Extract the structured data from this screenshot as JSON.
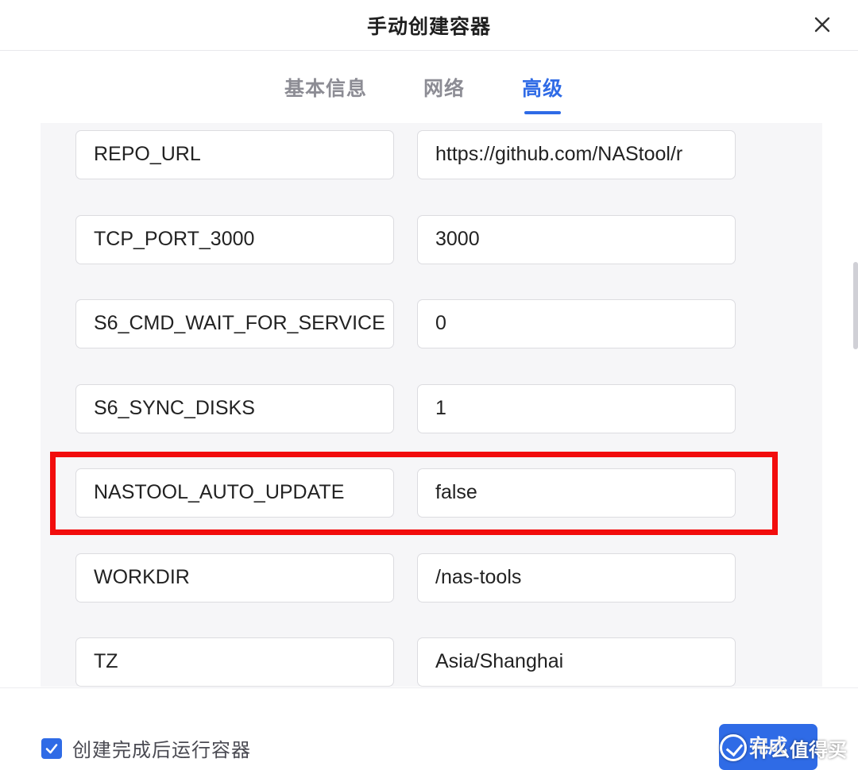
{
  "dialog": {
    "title": "手动创建容器",
    "close_icon": "close-icon"
  },
  "tabs": [
    {
      "label": "基本信息",
      "active": false
    },
    {
      "label": "网络",
      "active": false
    },
    {
      "label": "高级",
      "active": true
    }
  ],
  "env_vars": [
    {
      "key": "REPO_URL",
      "value": "https://github.com/NAStool/r"
    },
    {
      "key": "TCP_PORT_3000",
      "value": "3000"
    },
    {
      "key": "S6_CMD_WAIT_FOR_SERVICE",
      "value": "0"
    },
    {
      "key": "S6_SYNC_DISKS",
      "value": "1"
    },
    {
      "key": "NASTOOL_AUTO_UPDATE",
      "value": "false",
      "highlighted": true
    },
    {
      "key": "WORKDIR",
      "value": "/nas-tools"
    },
    {
      "key": "TZ",
      "value": "Asia/Shanghai"
    }
  ],
  "footer": {
    "run_after_create_label": "创建完成后运行容器",
    "run_after_create_checked": true,
    "finish_button_label": "完成"
  },
  "watermark": {
    "text": "什么值得买"
  },
  "colors": {
    "accent": "#2f6be6",
    "highlight": "#f20d0d",
    "tab_inactive": "#8c8c94"
  }
}
